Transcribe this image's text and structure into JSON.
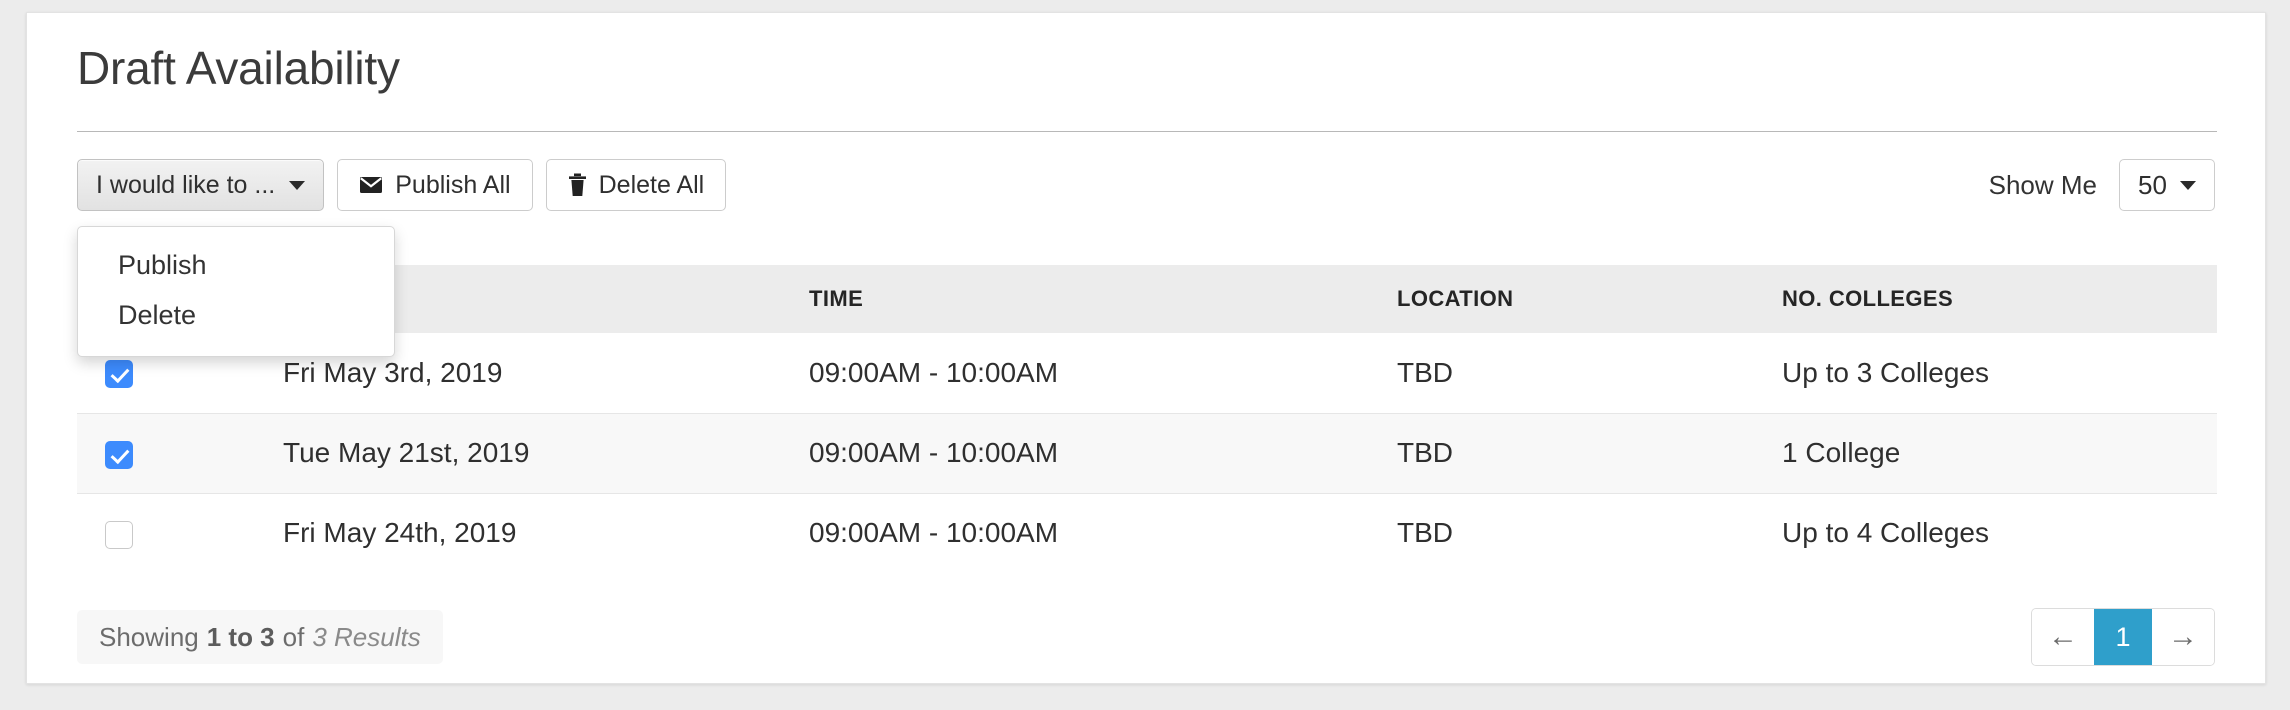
{
  "card": {
    "title": "Draft Availability"
  },
  "toolbar": {
    "dropdown_label": "I would like to ...",
    "dropdown_items": [
      {
        "label": "Publish"
      },
      {
        "label": "Delete"
      }
    ],
    "publish_all_label": "Publish All",
    "delete_all_label": "Delete All",
    "publish_icon": "mail-icon",
    "delete_icon": "trash-icon",
    "caret_icon": "caret-down-icon"
  },
  "show_me": {
    "label": "Show Me",
    "value": "50",
    "caret_icon": "caret-down-icon"
  },
  "table": {
    "headers": {
      "check": "",
      "date": "",
      "time": "TIME",
      "location": "LOCATION",
      "colleges": "NO. COLLEGES"
    },
    "rows": [
      {
        "checked": true,
        "date": "Fri May 3rd, 2019",
        "time": "09:00AM - 10:00AM",
        "location": "TBD",
        "colleges": "Up to 3 Colleges"
      },
      {
        "checked": true,
        "date": "Tue May 21st, 2019",
        "time": "09:00AM - 10:00AM",
        "location": "TBD",
        "colleges": "1 College"
      },
      {
        "checked": false,
        "date": "Fri May 24th, 2019",
        "time": "09:00AM - 10:00AM",
        "location": "TBD",
        "colleges": "Up to 4 Colleges"
      }
    ]
  },
  "footer": {
    "showing_prefix": "Showing",
    "showing_range": "1 to 3",
    "showing_of": "of",
    "showing_total": "3 Results",
    "pager": {
      "prev_icon": "arrow-left-icon",
      "prev_label": "←",
      "current_page": "1",
      "next_icon": "arrow-right-icon",
      "next_label": "→"
    }
  },
  "colors": {
    "accent_blue": "#2f9fcb",
    "checkbox_blue": "#3d8bfd",
    "page_background": "#ececec",
    "card_background": "#ffffff",
    "header_background": "#ececec"
  }
}
